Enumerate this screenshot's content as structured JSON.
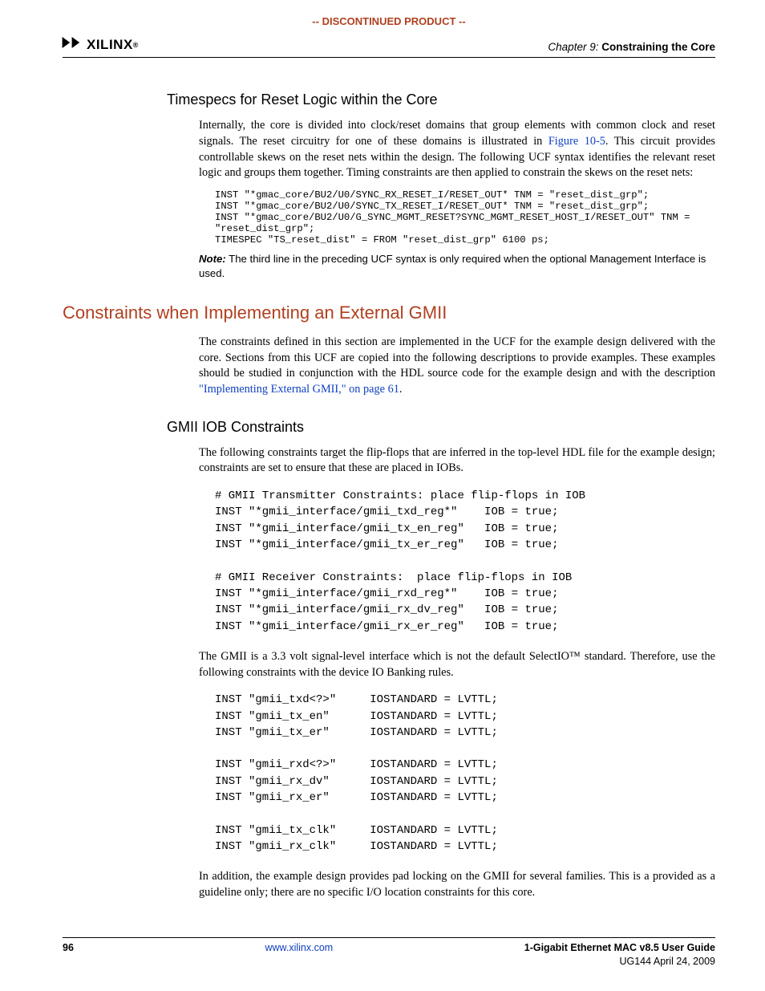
{
  "banner": "-- DISCONTINUED PRODUCT --",
  "logo_text": "XILINX",
  "chapter_label": "Chapter 9:",
  "chapter_title": "Constraining the Core",
  "section1": {
    "heading": "Timespecs for Reset Logic within the Core",
    "para1_a": "Internally, the core is divided into clock/reset domains that group elements with common clock and reset signals. The reset circuitry for one of these domains is illustrated in ",
    "link1": "Figure 10-5",
    "para1_b": ". This circuit provides controllable skews on the reset nets within the design. The following UCF syntax identifies the relevant reset logic and groups them together. Timing constraints are then applied to constrain the skews on the reset nets:",
    "code1": "INST \"*gmac_core/BU2/U0/SYNC_RX_RESET_I/RESET_OUT* TNM = \"reset_dist_grp\";\nINST \"*gmac_core/BU2/U0/SYNC_TX_RESET_I/RESET_OUT* TNM = \"reset_dist_grp\";\nINST \"*gmac_core/BU2/U0/G_SYNC_MGMT_RESET?SYNC_MGMT_RESET_HOST_I/RESET_OUT\" TNM = \n\"reset_dist_grp\";\nTIMESPEC \"TS_reset_dist\" = FROM \"reset_dist_grp\" 6100 ps;",
    "note_label": "Note:",
    "note_text": "The third line in the preceding UCF syntax is only required when the optional Management Interface is used."
  },
  "section2": {
    "heading": "Constraints when Implementing an External GMII",
    "para1_a": "The constraints defined in this section are implemented in the UCF for the example design delivered with the core. Sections from this UCF are copied into the following descriptions to provide examples. These examples should be studied in conjunction with the HDL source code for the example design and with the description ",
    "link1": "\"Implementing External GMII,\" on page 61",
    "para1_b": "."
  },
  "section3": {
    "heading": "GMII IOB Constraints",
    "para1": "The following constraints target the flip-flops that are inferred in the top-level HDL file for the example design; constraints are set to ensure that these are placed in IOBs.",
    "code1": "# GMII Transmitter Constraints: place flip-flops in IOB\nINST \"*gmii_interface/gmii_txd_reg*\"    IOB = true;\nINST \"*gmii_interface/gmii_tx_en_reg\"   IOB = true;\nINST \"*gmii_interface/gmii_tx_er_reg\"   IOB = true;\n\n# GMII Receiver Constraints:  place flip-flops in IOB\nINST \"*gmii_interface/gmii_rxd_reg*\"    IOB = true;\nINST \"*gmii_interface/gmii_rx_dv_reg\"   IOB = true;\nINST \"*gmii_interface/gmii_rx_er_reg\"   IOB = true;",
    "para2": "The GMII is a 3.3 volt signal-level interface which is not the default SelectIO™ standard. Therefore, use the following constraints with the device IO Banking rules.",
    "code2": "INST \"gmii_txd<?>\"     IOSTANDARD = LVTTL;\nINST \"gmii_tx_en\"      IOSTANDARD = LVTTL;\nINST \"gmii_tx_er\"      IOSTANDARD = LVTTL;\n\nINST \"gmii_rxd<?>\"     IOSTANDARD = LVTTL;\nINST \"gmii_rx_dv\"      IOSTANDARD = LVTTL;\nINST \"gmii_rx_er\"      IOSTANDARD = LVTTL;\n\nINST \"gmii_tx_clk\"     IOSTANDARD = LVTTL;\nINST \"gmii_rx_clk\"     IOSTANDARD = LVTTL;",
    "para3": "In addition, the example design provides pad locking on the GMII for several families. This is a provided as a guideline only; there are no specific I/O location constraints for this core."
  },
  "footer": {
    "page": "96",
    "url": "www.xilinx.com",
    "title": "1-Gigabit Ethernet MAC v8.5 User Guide",
    "doc": "UG144 April 24, 2009"
  }
}
